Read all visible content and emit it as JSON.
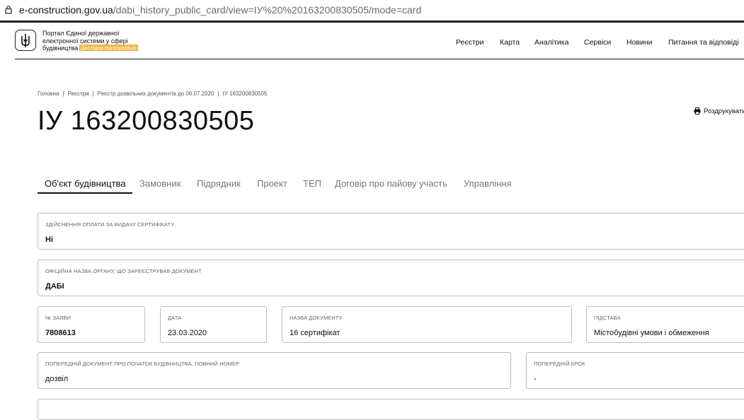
{
  "browser": {
    "url_domain": "e-construction.gov.ua",
    "url_path": "/dabi_history_public_card/view=ІУ%20%20163200830505/mode=card"
  },
  "header": {
    "brand_line1": "Портал Єдиної державної",
    "brand_line2": "електронної системи у сфері",
    "brand_line3": "будівництва",
    "badge": "Дослідна експлуатація",
    "nav": [
      "Реєстри",
      "Карта",
      "Аналітика",
      "Сервіси",
      "Новини",
      "Питання та відповіді"
    ]
  },
  "breadcrumb": [
    "Головна",
    "Реєстри",
    "Реєстр дозвільних документів до 06.07.2020",
    "ІУ 163200830505"
  ],
  "page": {
    "title": "ІУ 163200830505",
    "print_label": "Роздрукувати"
  },
  "tabs": [
    "Об'єкт будівництва",
    "Замовник",
    "Підрядник",
    "Проект",
    "ТЕП",
    "Договір про пайову участь",
    "Управління"
  ],
  "fields": {
    "payment": {
      "label": "Здійснення оплати за видачу сертифікату",
      "value": "Ні"
    },
    "organ": {
      "label": "Офіційна назва органу, що зареєстрував документ",
      "value": "ДАБІ"
    },
    "app_no": {
      "label": "№ заяви",
      "value": "7808613"
    },
    "date": {
      "label": "Дата",
      "value": "23.03.2020"
    },
    "doc_name": {
      "label": "Назва документу",
      "value": "16 сертифікат"
    },
    "basis": {
      "label": "Підстава",
      "value": "Містобудівні умови і обмеження"
    },
    "prev_doc": {
      "label": "Попередній документ про початок будівництва, повний номер",
      "value": "дозвіл"
    },
    "prev_step": {
      "label": "Попередній крок",
      "value": "-"
    }
  },
  "colors": {
    "badge": "#efb545",
    "text": "#111111",
    "muted": "#777777",
    "border": "#bdbdbd"
  }
}
